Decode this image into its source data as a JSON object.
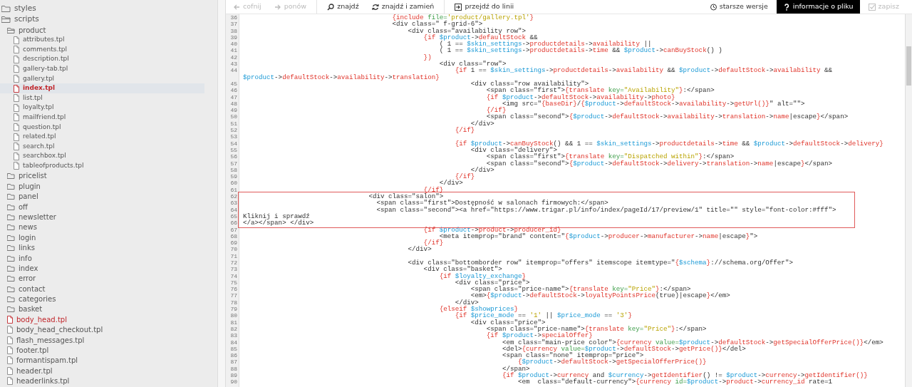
{
  "sidebar": {
    "items": [
      {
        "kind": "folder",
        "label": "styles",
        "expanded": false,
        "selected": false
      },
      {
        "kind": "folder",
        "label": "scripts",
        "expanded": true,
        "selected": false,
        "children": [
          {
            "kind": "folder",
            "label": "product",
            "expanded": true,
            "selected": false,
            "children": [
              {
                "kind": "file",
                "label": "attributes.tpl",
                "selected": false,
                "modified": false
              },
              {
                "kind": "file",
                "label": "comments.tpl",
                "selected": false,
                "modified": false
              },
              {
                "kind": "file",
                "label": "description.tpl",
                "selected": false,
                "modified": false
              },
              {
                "kind": "file",
                "label": "gallery-tab.tpl",
                "selected": false,
                "modified": false
              },
              {
                "kind": "file",
                "label": "gallery.tpl",
                "selected": false,
                "modified": false
              },
              {
                "kind": "file",
                "label": "index.tpl",
                "selected": true,
                "modified": true
              },
              {
                "kind": "file",
                "label": "list.tpl",
                "selected": false,
                "modified": false
              },
              {
                "kind": "file",
                "label": "loyalty.tpl",
                "selected": false,
                "modified": false
              },
              {
                "kind": "file",
                "label": "mailfriend.tpl",
                "selected": false,
                "modified": false
              },
              {
                "kind": "file",
                "label": "question.tpl",
                "selected": false,
                "modified": false
              },
              {
                "kind": "file",
                "label": "related.tpl",
                "selected": false,
                "modified": false
              },
              {
                "kind": "file",
                "label": "search.tpl",
                "selected": false,
                "modified": false
              },
              {
                "kind": "file",
                "label": "searchbox.tpl",
                "selected": false,
                "modified": false
              },
              {
                "kind": "file",
                "label": "tableofproducts.tpl",
                "selected": false,
                "modified": false
              }
            ]
          },
          {
            "kind": "folder",
            "label": "pricelist",
            "expanded": false,
            "selected": false
          },
          {
            "kind": "folder",
            "label": "plugin",
            "expanded": false,
            "selected": false
          },
          {
            "kind": "folder",
            "label": "panel",
            "expanded": false,
            "selected": false
          },
          {
            "kind": "folder",
            "label": "off",
            "expanded": false,
            "selected": false
          },
          {
            "kind": "folder",
            "label": "newsletter",
            "expanded": false,
            "selected": false
          },
          {
            "kind": "folder",
            "label": "news",
            "expanded": false,
            "selected": false
          },
          {
            "kind": "folder",
            "label": "login",
            "expanded": false,
            "selected": false
          },
          {
            "kind": "folder",
            "label": "links",
            "expanded": false,
            "selected": false
          },
          {
            "kind": "folder",
            "label": "info",
            "expanded": false,
            "selected": false
          },
          {
            "kind": "folder",
            "label": "index",
            "expanded": false,
            "selected": false
          },
          {
            "kind": "folder",
            "label": "error",
            "expanded": false,
            "selected": false
          },
          {
            "kind": "folder",
            "label": "contact",
            "expanded": false,
            "selected": false
          },
          {
            "kind": "folder",
            "label": "categories",
            "expanded": false,
            "selected": false
          },
          {
            "kind": "folder",
            "label": "basket",
            "expanded": false,
            "selected": false
          },
          {
            "kind": "file",
            "label": "body_head.tpl",
            "selected": false,
            "modified": true
          },
          {
            "kind": "file",
            "label": "body_head_checkout.tpl",
            "selected": false,
            "modified": false
          },
          {
            "kind": "file",
            "label": "flash_messages.tpl",
            "selected": false,
            "modified": false
          },
          {
            "kind": "file",
            "label": "footer.tpl",
            "selected": false,
            "modified": false
          },
          {
            "kind": "file",
            "label": "formantispam.tpl",
            "selected": false,
            "modified": false
          },
          {
            "kind": "file",
            "label": "header.tpl",
            "selected": false,
            "modified": false
          },
          {
            "kind": "file",
            "label": "headerlinks.tpl",
            "selected": false,
            "modified": false
          }
        ]
      }
    ]
  },
  "toolbar": {
    "groups": [
      [
        {
          "kind": "undo",
          "label": "cofnij",
          "disabled": true,
          "selected": false
        },
        {
          "kind": "redo",
          "label": "ponów",
          "disabled": true,
          "selected": false
        }
      ],
      [
        {
          "kind": "find",
          "label": "znajdź",
          "disabled": false,
          "selected": false
        },
        {
          "kind": "replace",
          "label": "znajdź i zamień",
          "disabled": false,
          "selected": false
        }
      ],
      [
        {
          "kind": "goto",
          "label": "przejdź do linii",
          "disabled": false,
          "selected": false
        }
      ]
    ],
    "right": [
      {
        "kind": "history",
        "label": "starsze wersje",
        "disabled": false,
        "selected": false
      },
      {
        "kind": "info",
        "label": "informacje o pliku",
        "disabled": false,
        "selected": true
      },
      {
        "kind": "save",
        "label": "zapisz",
        "disabled": true,
        "selected": false
      }
    ]
  },
  "editor": {
    "lines": [
      {
        "n": "36",
        "highlighted": false,
        "code": [
          {
            "text": "                                      {include ",
            "kind": "smarty"
          },
          {
            "text": "file=",
            "kind": "attr"
          },
          {
            "text": "'product/gallery.tpl'",
            "kind": "string"
          },
          {
            "text": "}",
            "kind": "smarty"
          }
        ]
      },
      {
        "n": "37",
        "highlighted": false,
        "code": [
          {
            "text": "                                      <div class=\" f-grid-6\">",
            "kind": "plain"
          }
        ]
      },
      {
        "n": "38",
        "highlighted": false,
        "code": [
          {
            "text": "                                          <div class=\"availability row\">",
            "kind": "plain"
          }
        ]
      },
      {
        "n": "39",
        "highlighted": false,
        "code": [
          {
            "text": "                                              {if ",
            "kind": "smarty"
          },
          {
            "text": "$product",
            "kind": "var"
          },
          {
            "text": "->",
            "kind": "plain"
          },
          {
            "text": "defaultStock",
            "kind": "smarty"
          },
          {
            "text": " &&",
            "kind": "plain"
          }
        ]
      },
      {
        "n": "40",
        "highlighted": false,
        "code": [
          {
            "text": "                                                  ( 1 == ",
            "kind": "plain"
          },
          {
            "text": "$skin_settings",
            "kind": "var"
          },
          {
            "text": "->",
            "kind": "plain"
          },
          {
            "text": "productdetails",
            "kind": "smarty"
          },
          {
            "text": "->",
            "kind": "plain"
          },
          {
            "text": "availability",
            "kind": "smarty"
          },
          {
            "text": " ||",
            "kind": "plain"
          }
        ]
      },
      {
        "n": "41",
        "highlighted": false,
        "code": [
          {
            "text": "                                                  ( 1 == ",
            "kind": "plain"
          },
          {
            "text": "$skin_settings",
            "kind": "var"
          },
          {
            "text": "->",
            "kind": "plain"
          },
          {
            "text": "productdetails",
            "kind": "smarty"
          },
          {
            "text": "->",
            "kind": "plain"
          },
          {
            "text": "time",
            "kind": "smarty"
          },
          {
            "text": " && ",
            "kind": "plain"
          },
          {
            "text": "$product",
            "kind": "var"
          },
          {
            "text": "->",
            "kind": "plain"
          },
          {
            "text": "canBuyStock",
            "kind": "smarty"
          },
          {
            "text": "() )",
            "kind": "plain"
          }
        ]
      },
      {
        "n": "42",
        "highlighted": false,
        "code": [
          {
            "text": "                                              })",
            "kind": "smarty"
          }
        ]
      },
      {
        "n": "43",
        "highlighted": false,
        "code": [
          {
            "text": "                                                  <div class=\"row\">",
            "kind": "plain"
          }
        ]
      },
      {
        "n": "44",
        "highlighted": false,
        "code": [
          {
            "text": "                                                      {if ",
            "kind": "smarty"
          },
          {
            "text": "1 == ",
            "kind": "plain"
          },
          {
            "text": "$skin_settings",
            "kind": "var"
          },
          {
            "text": "->",
            "kind": "plain"
          },
          {
            "text": "productdetails",
            "kind": "smarty"
          },
          {
            "text": "->",
            "kind": "plain"
          },
          {
            "text": "availability",
            "kind": "smarty"
          },
          {
            "text": " && ",
            "kind": "plain"
          },
          {
            "text": "$product",
            "kind": "var"
          },
          {
            "text": "->",
            "kind": "plain"
          },
          {
            "text": "defaultStock",
            "kind": "smarty"
          },
          {
            "text": "->",
            "kind": "plain"
          },
          {
            "text": "availability",
            "kind": "smarty"
          },
          {
            "text": " &&",
            "kind": "plain"
          }
        ],
        "wrapped": [
          {
            "text": "$product",
            "kind": "var"
          },
          {
            "text": "->",
            "kind": "plain"
          },
          {
            "text": "defaultStock",
            "kind": "smarty"
          },
          {
            "text": "->",
            "kind": "plain"
          },
          {
            "text": "availability",
            "kind": "smarty"
          },
          {
            "text": "->",
            "kind": "plain"
          },
          {
            "text": "translation",
            "kind": "smarty"
          },
          {
            "text": "}",
            "kind": "smarty"
          }
        ]
      },
      {
        "n": "45",
        "highlighted": false,
        "code": [
          {
            "text": "                                                          <div class=\"row availability\">",
            "kind": "plain"
          }
        ]
      },
      {
        "n": "46",
        "highlighted": false,
        "code": [
          {
            "text": "                                                              <span class=\"first\">",
            "kind": "plain"
          },
          {
            "text": "{translate ",
            "kind": "smarty"
          },
          {
            "text": "key=",
            "kind": "attr"
          },
          {
            "text": "\"Availability\"",
            "kind": "string"
          },
          {
            "text": "}",
            "kind": "smarty"
          },
          {
            "text": ":</span>",
            "kind": "plain"
          }
        ]
      },
      {
        "n": "47",
        "highlighted": false,
        "code": [
          {
            "text": "                                                              {if ",
            "kind": "smarty"
          },
          {
            "text": "$product",
            "kind": "var"
          },
          {
            "text": "->",
            "kind": "plain"
          },
          {
            "text": "defaultStock",
            "kind": "smarty"
          },
          {
            "text": "->",
            "kind": "plain"
          },
          {
            "text": "availability",
            "kind": "smarty"
          },
          {
            "text": "->",
            "kind": "plain"
          },
          {
            "text": "photo",
            "kind": "smarty"
          },
          {
            "text": "}",
            "kind": "smarty"
          }
        ]
      },
      {
        "n": "48",
        "highlighted": false,
        "code": [
          {
            "text": "                                                                  <img src=\"",
            "kind": "plain"
          },
          {
            "text": "{baseDir}",
            "kind": "smarty"
          },
          {
            "text": "/",
            "kind": "plain"
          },
          {
            "text": "{",
            "kind": "smarty"
          },
          {
            "text": "$product",
            "kind": "var"
          },
          {
            "text": "->",
            "kind": "plain"
          },
          {
            "text": "defaultStock",
            "kind": "smarty"
          },
          {
            "text": "->",
            "kind": "plain"
          },
          {
            "text": "availability",
            "kind": "smarty"
          },
          {
            "text": "->",
            "kind": "plain"
          },
          {
            "text": "getUrl",
            "kind": "smarty"
          },
          {
            "text": "()}",
            "kind": "smarty"
          },
          {
            "text": "\" alt=\"\">",
            "kind": "plain"
          }
        ]
      },
      {
        "n": "49",
        "highlighted": false,
        "code": [
          {
            "text": "                                                              {/if}",
            "kind": "smarty"
          }
        ]
      },
      {
        "n": "50",
        "highlighted": false,
        "code": [
          {
            "text": "                                                              <span class=\"second\">",
            "kind": "plain"
          },
          {
            "text": "{",
            "kind": "smarty"
          },
          {
            "text": "$product",
            "kind": "var"
          },
          {
            "text": "->",
            "kind": "plain"
          },
          {
            "text": "defaultStock",
            "kind": "smarty"
          },
          {
            "text": "->",
            "kind": "plain"
          },
          {
            "text": "availability",
            "kind": "smarty"
          },
          {
            "text": "->",
            "kind": "plain"
          },
          {
            "text": "translation",
            "kind": "smarty"
          },
          {
            "text": "->",
            "kind": "plain"
          },
          {
            "text": "name",
            "kind": "smarty"
          },
          {
            "text": "|escape",
            "kind": "plain"
          },
          {
            "text": "}",
            "kind": "smarty"
          },
          {
            "text": "</span>",
            "kind": "plain"
          }
        ]
      },
      {
        "n": "51",
        "highlighted": false,
        "code": [
          {
            "text": "                                                          </div>",
            "kind": "plain"
          }
        ]
      },
      {
        "n": "52",
        "highlighted": false,
        "code": [
          {
            "text": "                                                      {/if}",
            "kind": "smarty"
          }
        ]
      },
      {
        "n": "53",
        "highlighted": false
      },
      {
        "n": "54",
        "highlighted": false,
        "code": [
          {
            "text": "                                                      {if ",
            "kind": "smarty"
          },
          {
            "text": "$product",
            "kind": "var"
          },
          {
            "text": "->",
            "kind": "plain"
          },
          {
            "text": "canBuyStock",
            "kind": "smarty"
          },
          {
            "text": "() && 1 == ",
            "kind": "plain"
          },
          {
            "text": "$skin_settings",
            "kind": "var"
          },
          {
            "text": "->",
            "kind": "plain"
          },
          {
            "text": "productdetails",
            "kind": "smarty"
          },
          {
            "text": "->",
            "kind": "plain"
          },
          {
            "text": "time",
            "kind": "smarty"
          },
          {
            "text": " && ",
            "kind": "plain"
          },
          {
            "text": "$product",
            "kind": "var"
          },
          {
            "text": "->",
            "kind": "plain"
          },
          {
            "text": "defaultStock",
            "kind": "smarty"
          },
          {
            "text": "->",
            "kind": "plain"
          },
          {
            "text": "delivery",
            "kind": "smarty"
          },
          {
            "text": "}",
            "kind": "smarty"
          }
        ]
      },
      {
        "n": "55",
        "highlighted": false,
        "code": [
          {
            "text": "                                                          <div class=\"delivery\">",
            "kind": "plain"
          }
        ]
      },
      {
        "n": "56",
        "highlighted": false,
        "code": [
          {
            "text": "                                                              <span class=\"first\">",
            "kind": "plain"
          },
          {
            "text": "{translate ",
            "kind": "smarty"
          },
          {
            "text": "key=",
            "kind": "attr"
          },
          {
            "text": "\"Dispatched within\"",
            "kind": "string"
          },
          {
            "text": "}",
            "kind": "smarty"
          },
          {
            "text": ":</span>",
            "kind": "plain"
          }
        ]
      },
      {
        "n": "57",
        "highlighted": false,
        "code": [
          {
            "text": "                                                              <span class=\"second\">",
            "kind": "plain"
          },
          {
            "text": "{",
            "kind": "smarty"
          },
          {
            "text": "$product",
            "kind": "var"
          },
          {
            "text": "->",
            "kind": "plain"
          },
          {
            "text": "defaultStock",
            "kind": "smarty"
          },
          {
            "text": "->",
            "kind": "plain"
          },
          {
            "text": "delivery",
            "kind": "smarty"
          },
          {
            "text": "->",
            "kind": "plain"
          },
          {
            "text": "translation",
            "kind": "smarty"
          },
          {
            "text": "->",
            "kind": "plain"
          },
          {
            "text": "name",
            "kind": "smarty"
          },
          {
            "text": "|escape",
            "kind": "plain"
          },
          {
            "text": "}",
            "kind": "smarty"
          },
          {
            "text": "</span>",
            "kind": "plain"
          }
        ]
      },
      {
        "n": "58",
        "highlighted": false,
        "code": [
          {
            "text": "                                                          </div>",
            "kind": "plain"
          }
        ]
      },
      {
        "n": "59",
        "highlighted": false,
        "code": [
          {
            "text": "                                                      {/if}",
            "kind": "smarty"
          }
        ]
      },
      {
        "n": "60",
        "highlighted": false,
        "code": [
          {
            "text": "                                                  </div>",
            "kind": "plain"
          }
        ]
      },
      {
        "n": "61",
        "highlighted": false,
        "code": [
          {
            "text": "                                              {/if}",
            "kind": "smarty"
          }
        ]
      },
      {
        "n": "62",
        "highlighted": true,
        "code": [
          {
            "text": "                                <div class=\"salon\">",
            "kind": "plain"
          }
        ]
      },
      {
        "n": "63",
        "highlighted": true,
        "code": [
          {
            "text": "                                  <span class=\"first\">Dostępność w salonach firmowych:</span>",
            "kind": "plain"
          }
        ]
      },
      {
        "n": "64",
        "highlighted": true,
        "code": [
          {
            "text": "                                  <span class=\"second\"><a href=\"https://www.trigar.pl/info/index/pageId/17/preview/1\" title=\"\" style=\"font-color:#fff\">",
            "kind": "plain"
          }
        ]
      },
      {
        "n": "65",
        "highlighted": true,
        "code": [
          {
            "text": "Kliknij i sprawdź",
            "kind": "plain"
          }
        ]
      },
      {
        "n": "66",
        "highlighted": true,
        "code": [
          {
            "text": "</a></span> </div>",
            "kind": "plain"
          }
        ]
      },
      {
        "n": "67",
        "highlighted": false,
        "code": [
          {
            "text": "                                              {if ",
            "kind": "smarty"
          },
          {
            "text": "$product",
            "kind": "var"
          },
          {
            "text": "->",
            "kind": "plain"
          },
          {
            "text": "product",
            "kind": "smarty"
          },
          {
            "text": "->",
            "kind": "plain"
          },
          {
            "text": "producer_id",
            "kind": "smarty"
          },
          {
            "text": "}",
            "kind": "smarty"
          }
        ]
      },
      {
        "n": "68",
        "highlighted": false,
        "code": [
          {
            "text": "                                                  <meta itemprop=\"brand\" content=\"",
            "kind": "plain"
          },
          {
            "text": "{",
            "kind": "smarty"
          },
          {
            "text": "$product",
            "kind": "var"
          },
          {
            "text": "->",
            "kind": "plain"
          },
          {
            "text": "producer",
            "kind": "smarty"
          },
          {
            "text": "->",
            "kind": "plain"
          },
          {
            "text": "manufacturer",
            "kind": "smarty"
          },
          {
            "text": "->",
            "kind": "plain"
          },
          {
            "text": "name",
            "kind": "smarty"
          },
          {
            "text": "|escape",
            "kind": "plain"
          },
          {
            "text": "}",
            "kind": "smarty"
          },
          {
            "text": "\">",
            "kind": "plain"
          }
        ]
      },
      {
        "n": "69",
        "highlighted": false,
        "code": [
          {
            "text": "                                              {/if}",
            "kind": "smarty"
          }
        ]
      },
      {
        "n": "70",
        "highlighted": false,
        "code": [
          {
            "text": "                                          </div>",
            "kind": "plain"
          }
        ]
      },
      {
        "n": "71",
        "highlighted": false
      },
      {
        "n": "72",
        "highlighted": false,
        "code": [
          {
            "text": "                                          <div class=\"bottomborder row\" itemprop=\"offers\" itemscope itemtype=\"",
            "kind": "plain"
          },
          {
            "text": "{",
            "kind": "smarty"
          },
          {
            "text": "$schema",
            "kind": "var"
          },
          {
            "text": "}",
            "kind": "smarty"
          },
          {
            "text": "://schema.org/Offer\">",
            "kind": "plain"
          }
        ]
      },
      {
        "n": "73",
        "highlighted": false,
        "code": [
          {
            "text": "                                              <div class=\"basket\">",
            "kind": "plain"
          }
        ]
      },
      {
        "n": "74",
        "highlighted": false,
        "code": [
          {
            "text": "                                                  {if ",
            "kind": "smarty"
          },
          {
            "text": "$loyalty_exchange",
            "kind": "var"
          },
          {
            "text": "}",
            "kind": "smarty"
          }
        ]
      },
      {
        "n": "75",
        "highlighted": false,
        "code": [
          {
            "text": "                                                      <div class=\"price\">",
            "kind": "plain"
          }
        ]
      },
      {
        "n": "76",
        "highlighted": false,
        "code": [
          {
            "text": "                                                          <span class=\"price-name\">",
            "kind": "plain"
          },
          {
            "text": "{translate ",
            "kind": "smarty"
          },
          {
            "text": "key=",
            "kind": "attr"
          },
          {
            "text": "\"Price\"",
            "kind": "string"
          },
          {
            "text": "}",
            "kind": "smarty"
          },
          {
            "text": ":</span>",
            "kind": "plain"
          }
        ]
      },
      {
        "n": "77",
        "highlighted": false,
        "code": [
          {
            "text": "                                                          <em>",
            "kind": "plain"
          },
          {
            "text": "{",
            "kind": "smarty"
          },
          {
            "text": "$product",
            "kind": "var"
          },
          {
            "text": "->",
            "kind": "plain"
          },
          {
            "text": "defaultStock",
            "kind": "smarty"
          },
          {
            "text": "->",
            "kind": "plain"
          },
          {
            "text": "loyaltyPointsPrice",
            "kind": "smarty"
          },
          {
            "text": "(true)|escape",
            "kind": "plain"
          },
          {
            "text": "}",
            "kind": "smarty"
          },
          {
            "text": "</em>",
            "kind": "plain"
          }
        ]
      },
      {
        "n": "78",
        "highlighted": false,
        "code": [
          {
            "text": "                                                      </div>",
            "kind": "plain"
          }
        ]
      },
      {
        "n": "79",
        "highlighted": false,
        "code": [
          {
            "text": "                                                  {elseif ",
            "kind": "smarty"
          },
          {
            "text": "$showprices",
            "kind": "var"
          },
          {
            "text": "}",
            "kind": "smarty"
          }
        ]
      },
      {
        "n": "80",
        "highlighted": false,
        "code": [
          {
            "text": "                                                      {if ",
            "kind": "smarty"
          },
          {
            "text": "$price_mode",
            "kind": "var"
          },
          {
            "text": " == ",
            "kind": "plain"
          },
          {
            "text": "'1'",
            "kind": "string"
          },
          {
            "text": " || ",
            "kind": "plain"
          },
          {
            "text": "$price_mode",
            "kind": "var"
          },
          {
            "text": " == ",
            "kind": "plain"
          },
          {
            "text": "'3'",
            "kind": "string"
          },
          {
            "text": "}",
            "kind": "smarty"
          }
        ]
      },
      {
        "n": "81",
        "highlighted": false,
        "code": [
          {
            "text": "                                                          <div class=\"price\">",
            "kind": "plain"
          }
        ]
      },
      {
        "n": "82",
        "highlighted": false,
        "code": [
          {
            "text": "                                                              <span class=\"price-name\">",
            "kind": "plain"
          },
          {
            "text": "{translate ",
            "kind": "smarty"
          },
          {
            "text": "key=",
            "kind": "attr"
          },
          {
            "text": "\"Price\"",
            "kind": "string"
          },
          {
            "text": "}",
            "kind": "smarty"
          },
          {
            "text": ":</span>",
            "kind": "plain"
          }
        ]
      },
      {
        "n": "83",
        "highlighted": false,
        "code": [
          {
            "text": "                                                              {if ",
            "kind": "smarty"
          },
          {
            "text": "$product",
            "kind": "var"
          },
          {
            "text": "->",
            "kind": "plain"
          },
          {
            "text": "specialOffer",
            "kind": "smarty"
          },
          {
            "text": "}",
            "kind": "smarty"
          }
        ]
      },
      {
        "n": "84",
        "highlighted": false,
        "code": [
          {
            "text": "                                                                  <em class=\"main-price color\">",
            "kind": "plain"
          },
          {
            "text": "{currency ",
            "kind": "smarty"
          },
          {
            "text": "value=",
            "kind": "attr"
          },
          {
            "text": "$product",
            "kind": "var"
          },
          {
            "text": "->",
            "kind": "plain"
          },
          {
            "text": "defaultStock",
            "kind": "smarty"
          },
          {
            "text": "->",
            "kind": "plain"
          },
          {
            "text": "getSpecialOfferPrice",
            "kind": "smarty"
          },
          {
            "text": "()}",
            "kind": "smarty"
          },
          {
            "text": "</em>",
            "kind": "plain"
          }
        ]
      },
      {
        "n": "85",
        "highlighted": false,
        "code": [
          {
            "text": "                                                                  <del>",
            "kind": "plain"
          },
          {
            "text": "{currency ",
            "kind": "smarty"
          },
          {
            "text": "value=",
            "kind": "attr"
          },
          {
            "text": "$product",
            "kind": "var"
          },
          {
            "text": "->",
            "kind": "plain"
          },
          {
            "text": "defaultStock",
            "kind": "smarty"
          },
          {
            "text": "->",
            "kind": "plain"
          },
          {
            "text": "getPrice",
            "kind": "smarty"
          },
          {
            "text": "()}",
            "kind": "smarty"
          },
          {
            "text": "</del>",
            "kind": "plain"
          }
        ]
      },
      {
        "n": "86",
        "highlighted": false,
        "code": [
          {
            "text": "                                                                  <span class=\"none\" itemprop=\"price\">",
            "kind": "plain"
          }
        ]
      },
      {
        "n": "87",
        "highlighted": false,
        "code": [
          {
            "text": "                                                                      {",
            "kind": "smarty"
          },
          {
            "text": "$product",
            "kind": "var"
          },
          {
            "text": "->",
            "kind": "plain"
          },
          {
            "text": "defaultStock",
            "kind": "smarty"
          },
          {
            "text": "->",
            "kind": "plain"
          },
          {
            "text": "getSpecialOfferPrice",
            "kind": "smarty"
          },
          {
            "text": "()}",
            "kind": "smarty"
          }
        ]
      },
      {
        "n": "88",
        "highlighted": false,
        "code": [
          {
            "text": "                                                                  </span>",
            "kind": "plain"
          }
        ]
      },
      {
        "n": "89",
        "highlighted": false,
        "code": [
          {
            "text": "                                                                  {if ",
            "kind": "smarty"
          },
          {
            "text": "$product",
            "kind": "var"
          },
          {
            "text": "->",
            "kind": "plain"
          },
          {
            "text": "currency",
            "kind": "smarty"
          },
          {
            "text": " and ",
            "kind": "plain"
          },
          {
            "text": "$currency",
            "kind": "var"
          },
          {
            "text": "->",
            "kind": "plain"
          },
          {
            "text": "getIdentifier",
            "kind": "smarty"
          },
          {
            "text": "() != ",
            "kind": "plain"
          },
          {
            "text": "$product",
            "kind": "var"
          },
          {
            "text": "->",
            "kind": "plain"
          },
          {
            "text": "currency",
            "kind": "smarty"
          },
          {
            "text": "->",
            "kind": "plain"
          },
          {
            "text": "getIdentifier",
            "kind": "smarty"
          },
          {
            "text": "()}",
            "kind": "smarty"
          }
        ]
      },
      {
        "n": "90",
        "highlighted": false,
        "code": [
          {
            "text": "                                                                      <em  class=\"default-currency\">",
            "kind": "plain"
          },
          {
            "text": "{currency ",
            "kind": "smarty"
          },
          {
            "text": "id=",
            "kind": "attr"
          },
          {
            "text": "$product",
            "kind": "var"
          },
          {
            "text": "->",
            "kind": "plain"
          },
          {
            "text": "product",
            "kind": "smarty"
          },
          {
            "text": "->",
            "kind": "plain"
          },
          {
            "text": "currency_id",
            "kind": "smarty"
          },
          {
            "text": " rate=1",
            "kind": "plain"
          }
        ]
      }
    ]
  }
}
